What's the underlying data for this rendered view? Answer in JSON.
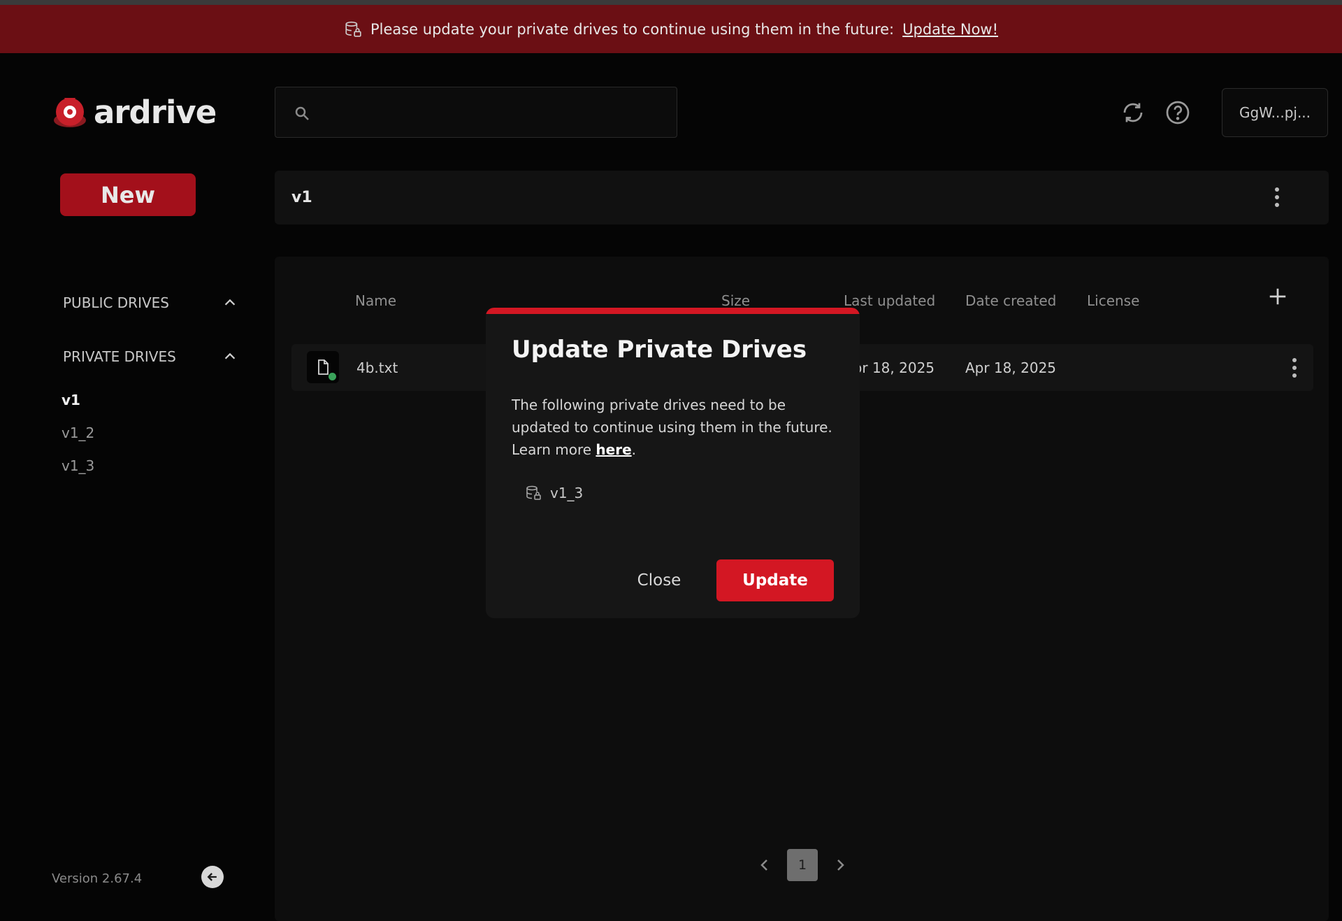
{
  "banner": {
    "message": "Please update your private drives to continue using them in the future:",
    "link_label": "Update Now!"
  },
  "sidebar": {
    "logo_text": "ardrive",
    "new_button": "New",
    "public_section": "PUBLIC DRIVES",
    "private_section": "PRIVATE DRIVES",
    "private_drives": [
      {
        "label": "v1",
        "active": true
      },
      {
        "label": "v1_2",
        "active": false
      },
      {
        "label": "v1_3",
        "active": false
      }
    ],
    "version": "Version 2.67.4"
  },
  "header": {
    "search_placeholder": "",
    "account_label": "GgW...pj..."
  },
  "breadcrumb": {
    "title": "v1"
  },
  "table": {
    "columns": [
      "Name",
      "Size",
      "Last updated",
      "Date created",
      "License"
    ],
    "rows": [
      {
        "name": "4b.txt",
        "size": "",
        "last_updated": "Apr 18, 2025",
        "date_created": "Apr 18, 2025",
        "license": ""
      }
    ]
  },
  "pagination": {
    "current_page": "1"
  },
  "modal": {
    "title": "Update Private Drives",
    "body_text": "The following private drives need to be updated to continue using them in the future. Learn more ",
    "link_label": "here",
    "body_end": ".",
    "drives": [
      "v1_3"
    ],
    "close_label": "Close",
    "update_label": "Update"
  },
  "colors": {
    "banner_bg": "#6b0f14",
    "accent_red": "#d31723",
    "new_button_bg": "#a3101b",
    "sync_status": "#3aa35a"
  },
  "icons": [
    "drive-lock-icon",
    "search-icon",
    "sync-icon",
    "help-icon",
    "chevron-up-icon",
    "more-vert-icon",
    "plus-icon",
    "file-icon",
    "chevron-left-icon",
    "chevron-right-icon",
    "arrow-left-icon"
  ]
}
